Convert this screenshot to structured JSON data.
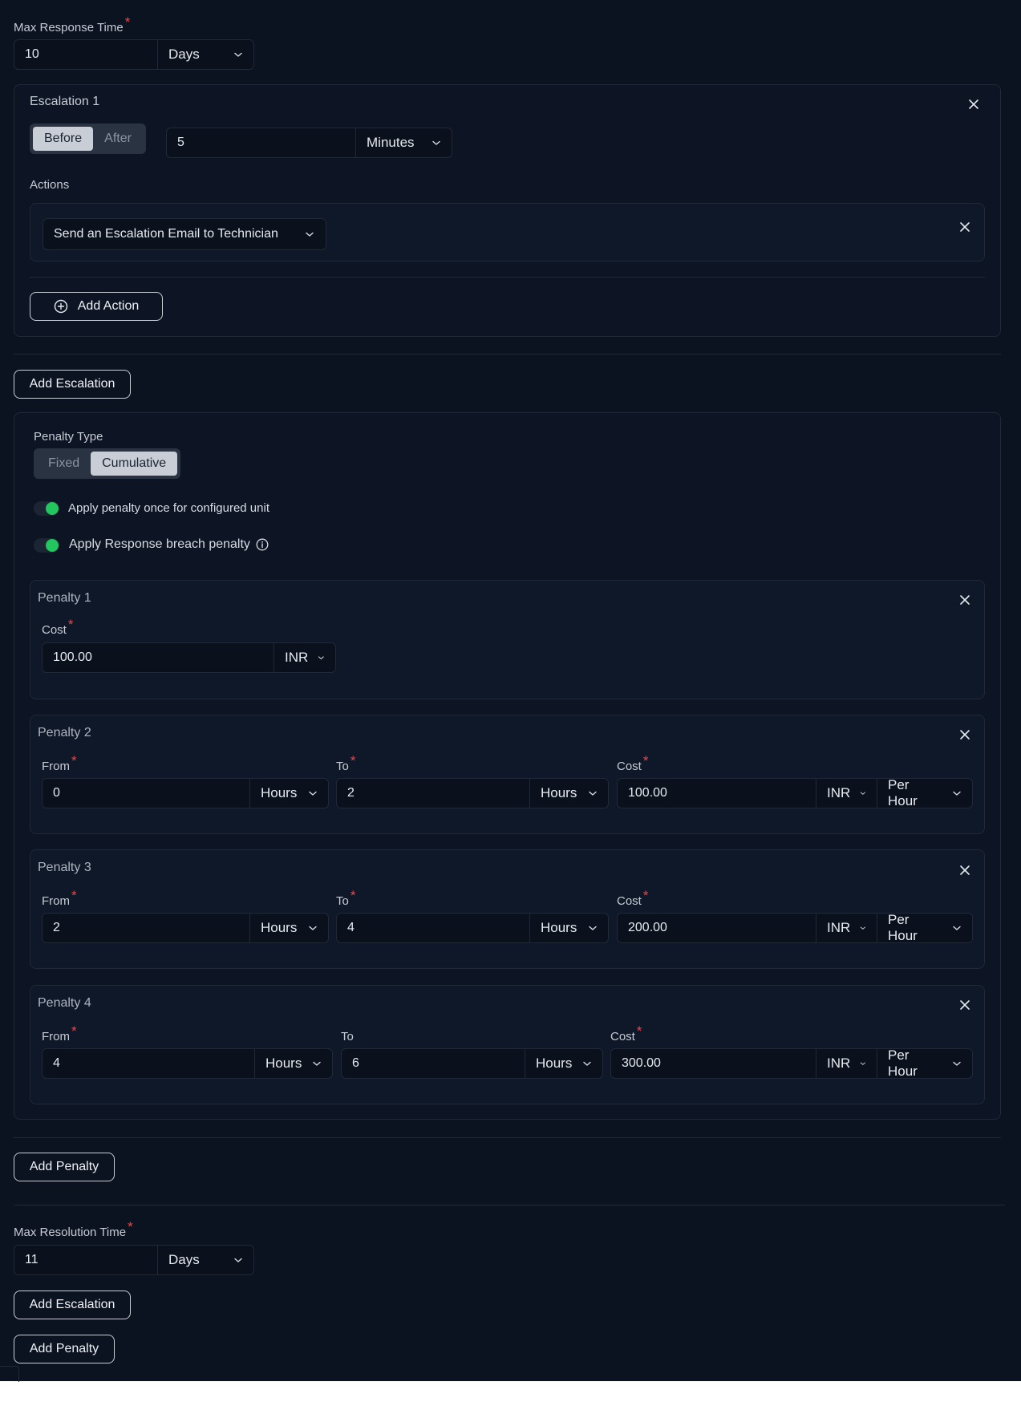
{
  "response": {
    "label": "Max Response Time",
    "value": "10",
    "unit": "Days"
  },
  "escalation1": {
    "title": "Escalation 1",
    "segment": {
      "before": "Before",
      "after": "After",
      "selected": "Before"
    },
    "value": "5",
    "unit": "Minutes",
    "actions_label": "Actions",
    "action": "Send an Escalation Email to Technician",
    "add_action": "Add Action"
  },
  "add_escalation": "Add Escalation",
  "penalty": {
    "type_label": "Penalty Type",
    "segment": {
      "fixed": "Fixed",
      "cumulative": "Cumulative",
      "selected": "Cumulative"
    },
    "toggle1": "Apply penalty once for configured unit",
    "toggle2": "Apply Response breach penalty",
    "p1": {
      "title": "Penalty 1",
      "cost_label": "Cost",
      "cost": "100.00",
      "currency": "INR"
    },
    "p2": {
      "title": "Penalty 2",
      "from_label": "From",
      "from": "0",
      "from_unit": "Hours",
      "to_label": "To",
      "to": "2",
      "to_unit": "Hours",
      "cost_label": "Cost",
      "cost": "100.00",
      "currency": "INR",
      "rate": "Per Hour"
    },
    "p3": {
      "title": "Penalty 3",
      "from_label": "From",
      "from": "2",
      "from_unit": "Hours",
      "to_label": "To",
      "to": "4",
      "to_unit": "Hours",
      "cost_label": "Cost",
      "cost": "200.00",
      "currency": "INR",
      "rate": "Per Hour"
    },
    "p4": {
      "title": "Penalty 4",
      "from_label": "From",
      "from": "4",
      "from_unit": "Hours",
      "to_label": "To",
      "to": "6",
      "to_unit": "Hours",
      "cost_label": "Cost",
      "cost": "300.00",
      "currency": "INR",
      "rate": "Per Hour"
    }
  },
  "add_penalty": "Add Penalty",
  "resolution": {
    "label": "Max Resolution Time",
    "value": "11",
    "unit": "Days"
  },
  "add_escalation2": "Add Escalation",
  "add_penalty2": "Add Penalty",
  "colors": {
    "accent_toggle": "#22c55e",
    "required": "#e5484d",
    "background": "#0b1220"
  }
}
